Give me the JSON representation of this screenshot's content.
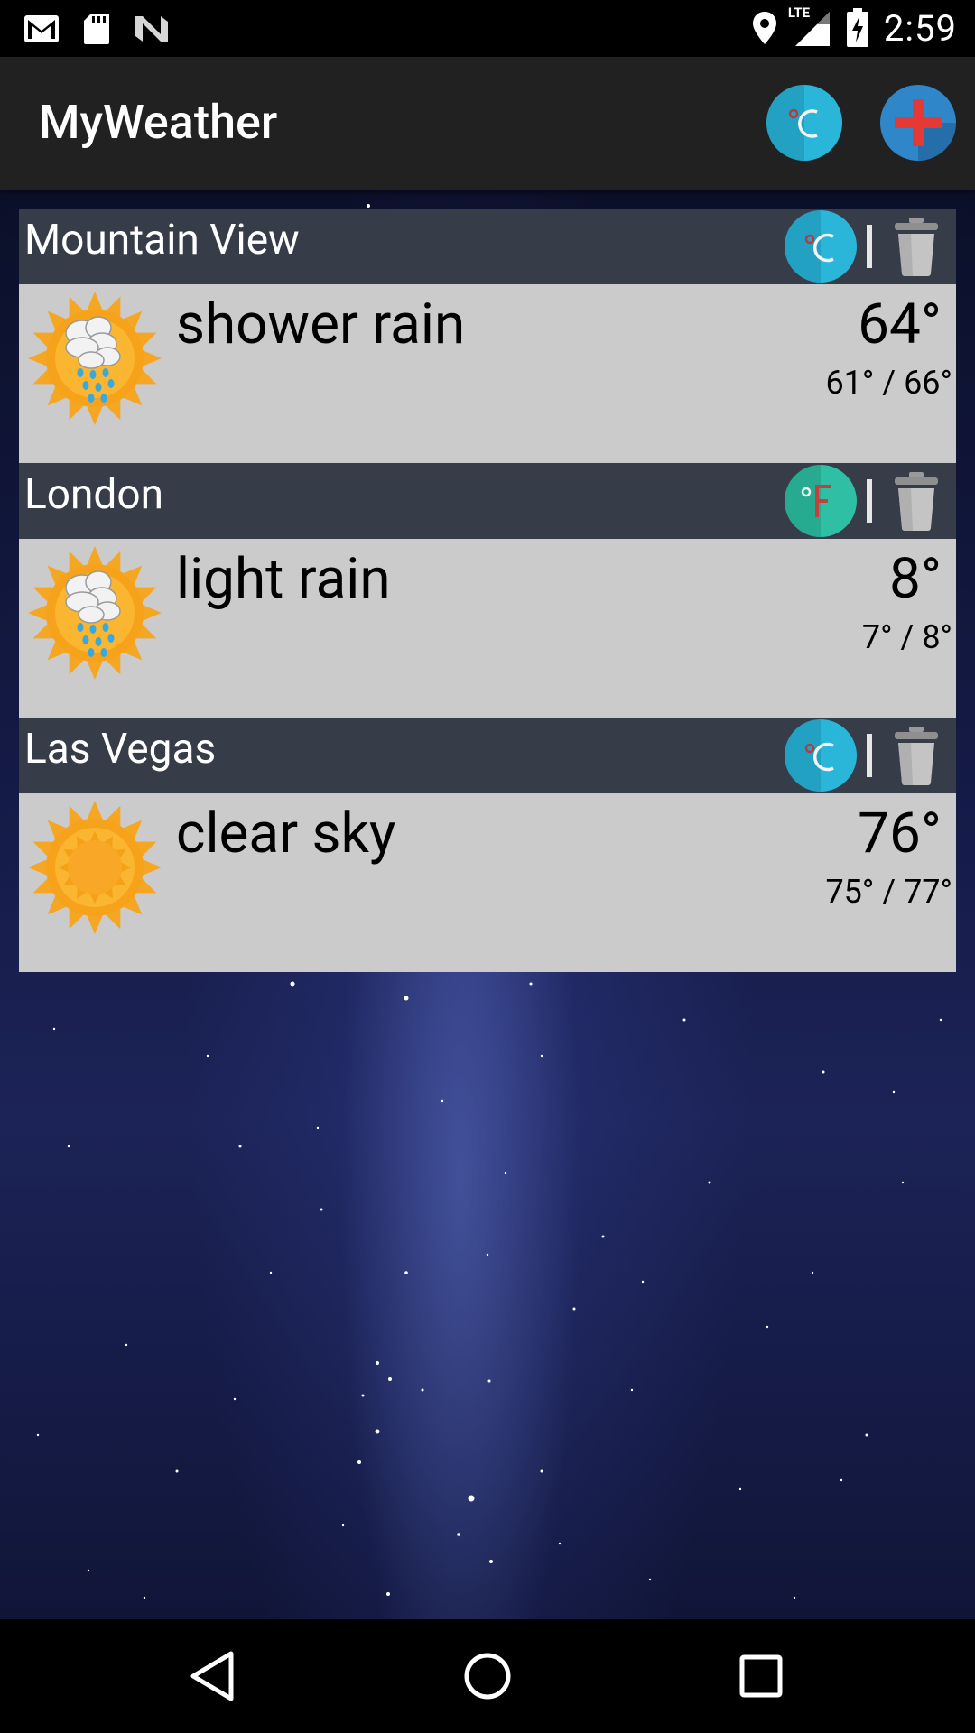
{
  "status_bar": {
    "time": "2:59",
    "network_label": "LTE",
    "icons": [
      "gmail-icon",
      "sd-card-icon",
      "n-icon",
      "location-icon",
      "signal-icon",
      "battery-charging-icon"
    ]
  },
  "app_bar": {
    "title": "MyWeather",
    "unit_button_label": "°C",
    "add_button_icon": "plus-icon"
  },
  "cities": [
    {
      "name": "Mountain View",
      "unit": "°C",
      "unit_symbol": "°",
      "unit_letter": "C",
      "unit_color": "#29b6d9",
      "description": "shower rain",
      "temp": "64°",
      "range": "61° / 66°",
      "icon": "sun-shower-rain-icon"
    },
    {
      "name": "London",
      "unit": "°F",
      "unit_symbol": "°",
      "unit_letter": "F",
      "unit_color": "#2fbfa5",
      "description": "light rain",
      "temp": "8°",
      "range": "7° / 8°",
      "icon": "sun-light-rain-icon"
    },
    {
      "name": "Las Vegas",
      "unit": "°C",
      "unit_symbol": "°",
      "unit_letter": "C",
      "unit_color": "#29b6d9",
      "description": "clear sky",
      "temp": "76°",
      "range": "75° / 77°",
      "icon": "sun-clear-sky-icon"
    }
  ],
  "nav_bar": {
    "icons": [
      "back-icon",
      "home-icon",
      "recents-icon"
    ]
  },
  "colors": {
    "app_bar": "#212121",
    "card_header": "#363c48",
    "card_body": "#cbcbcb",
    "celsius_accent": "#29b6d9",
    "fahrenheit_accent": "#2fbfa5",
    "add_button": "#2f86c9",
    "add_cross": "#e53935"
  }
}
